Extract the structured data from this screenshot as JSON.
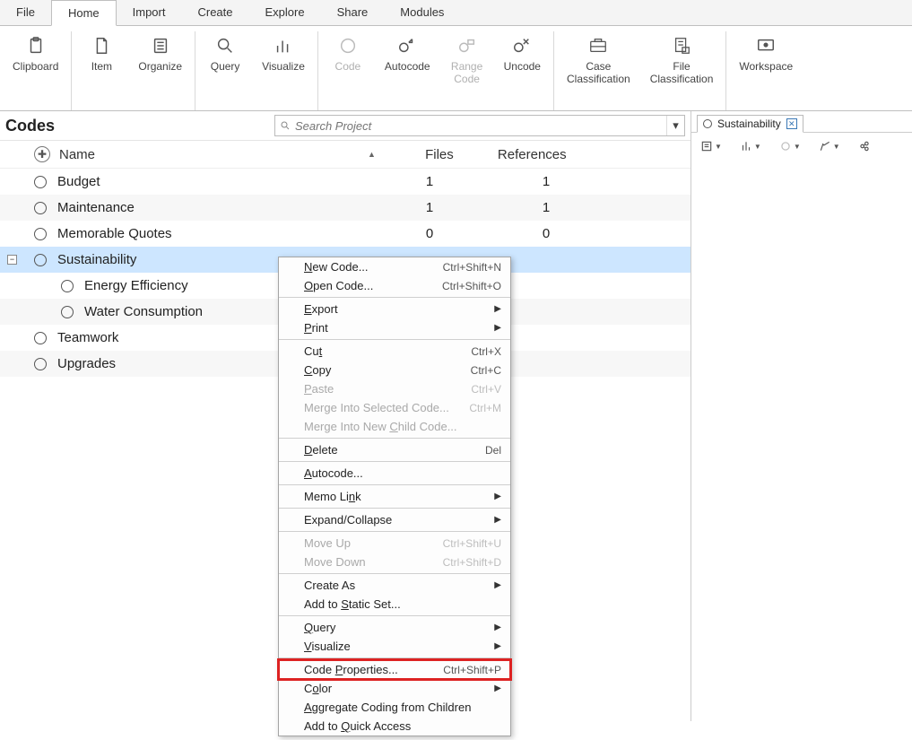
{
  "menubar": {
    "tabs": [
      "File",
      "Home",
      "Import",
      "Create",
      "Explore",
      "Share",
      "Modules"
    ],
    "active": "Home"
  },
  "ribbon": {
    "clipboard": "Clipboard",
    "item": "Item",
    "organize": "Organize",
    "query": "Query",
    "visualize": "Visualize",
    "code": "Code",
    "autocode": "Autocode",
    "range_code": "Range\nCode",
    "uncode": "Uncode",
    "case_class": "Case\nClassification",
    "file_class": "File\nClassification",
    "workspace": "Workspace"
  },
  "left_panel": {
    "title": "Codes",
    "search_placeholder": "Search Project",
    "columns": {
      "name": "Name",
      "files": "Files",
      "refs": "References"
    },
    "rows": [
      {
        "name": "Budget",
        "files": "1",
        "refs": "1",
        "level": 0,
        "selected": false,
        "stripe": false
      },
      {
        "name": "Maintenance",
        "files": "1",
        "refs": "1",
        "level": 0,
        "selected": false,
        "stripe": true
      },
      {
        "name": "Memorable Quotes",
        "files": "0",
        "refs": "0",
        "level": 0,
        "selected": false,
        "stripe": false
      },
      {
        "name": "Sustainability",
        "files": "",
        "refs": "",
        "level": 0,
        "selected": true,
        "stripe": false,
        "expandable": true
      },
      {
        "name": "Energy Efficiency",
        "files": "",
        "refs": "",
        "level": 1,
        "selected": false,
        "stripe": false
      },
      {
        "name": "Water Consumption",
        "files": "",
        "refs": "",
        "level": 1,
        "selected": false,
        "stripe": true
      },
      {
        "name": "Teamwork",
        "files": "",
        "refs": "",
        "level": 0,
        "selected": false,
        "stripe": false
      },
      {
        "name": "Upgrades",
        "files": "",
        "refs": "",
        "level": 0,
        "selected": false,
        "stripe": true
      }
    ]
  },
  "right_panel": {
    "tab_label": "Sustainability"
  },
  "context_menu": {
    "items": [
      {
        "label": "New Code...",
        "shortcut": "Ctrl+Shift+N",
        "u": 0
      },
      {
        "label": "Open Code...",
        "shortcut": "Ctrl+Shift+O",
        "u": 0
      },
      {
        "sep": true
      },
      {
        "label": "Export",
        "sub": true,
        "u": 0
      },
      {
        "label": "Print",
        "sub": true,
        "u": 0
      },
      {
        "sep": true
      },
      {
        "label": "Cut",
        "shortcut": "Ctrl+X",
        "u": 2
      },
      {
        "label": "Copy",
        "shortcut": "Ctrl+C",
        "u": 0
      },
      {
        "label": "Paste",
        "shortcut": "Ctrl+V",
        "disabled": true,
        "u": 0
      },
      {
        "label": "Merge Into Selected Code...",
        "shortcut": "Ctrl+M",
        "disabled": true
      },
      {
        "label": "Merge Into New Child Code...",
        "disabled": true,
        "u": 15
      },
      {
        "sep": true
      },
      {
        "label": "Delete",
        "shortcut": "Del",
        "u": 0
      },
      {
        "sep": true
      },
      {
        "label": "Autocode...",
        "u": 0
      },
      {
        "sep": true
      },
      {
        "label": "Memo Link",
        "sub": true,
        "u": 7
      },
      {
        "sep": true
      },
      {
        "label": "Expand/Collapse",
        "sub": true
      },
      {
        "sep": true
      },
      {
        "label": "Move Up",
        "shortcut": "Ctrl+Shift+U",
        "disabled": true
      },
      {
        "label": "Move Down",
        "shortcut": "Ctrl+Shift+D",
        "disabled": true
      },
      {
        "sep": true
      },
      {
        "label": "Create As",
        "sub": true
      },
      {
        "label": "Add to Static Set...",
        "u": 7
      },
      {
        "sep": true
      },
      {
        "label": "Query",
        "sub": true,
        "u": 0
      },
      {
        "label": "Visualize",
        "sub": true,
        "u": 0
      },
      {
        "sep": true
      },
      {
        "label": "Code Properties...",
        "shortcut": "Ctrl+Shift+P",
        "highlight": true,
        "u": 5
      },
      {
        "label": "Color",
        "sub": true,
        "u": 1
      },
      {
        "label": "Aggregate Coding from Children",
        "u": 0
      },
      {
        "label": "Add to Quick Access",
        "u": 7
      }
    ]
  }
}
